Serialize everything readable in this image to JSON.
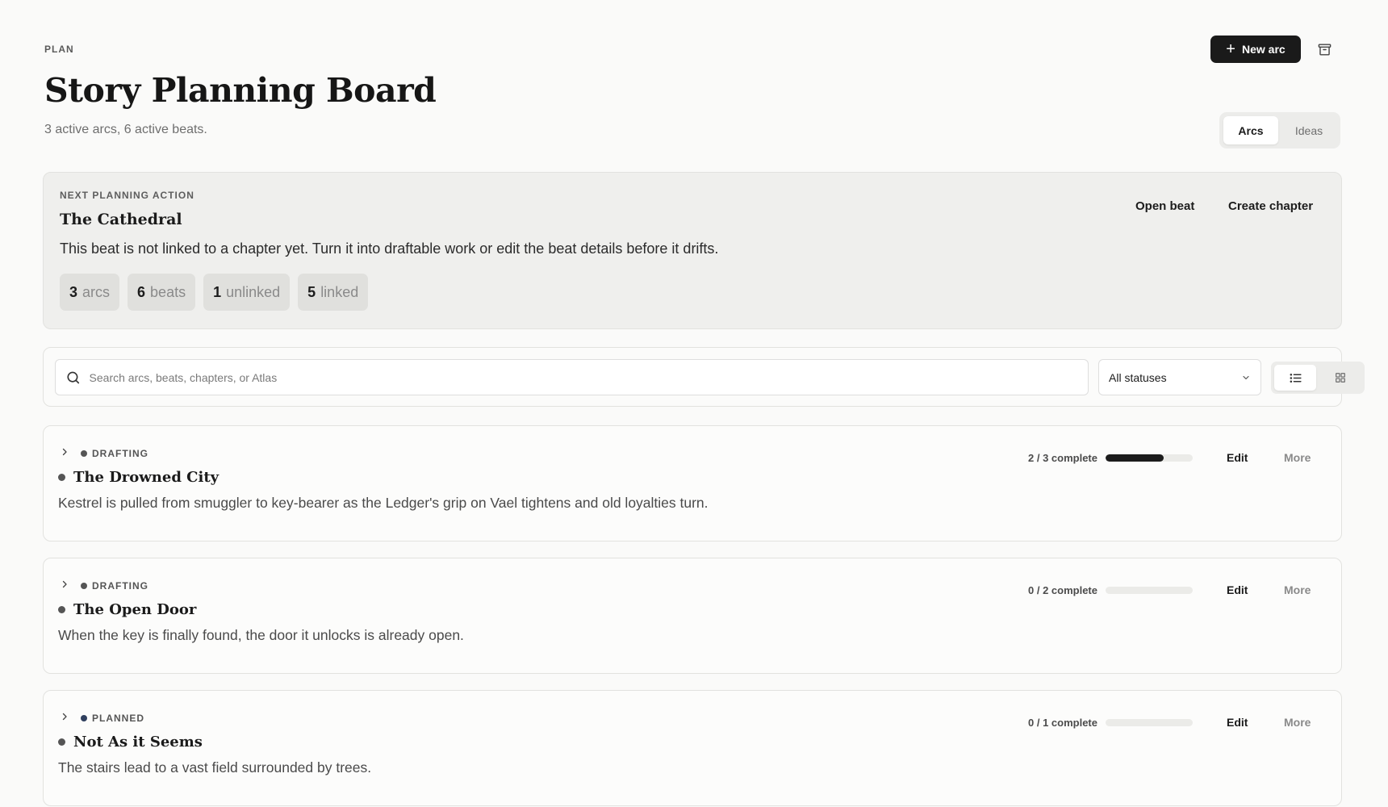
{
  "header": {
    "eyebrow": "PLAN",
    "title": "Story Planning Board",
    "subtitle": "3 active arcs, 6 active beats.",
    "new_arc_label": "New arc",
    "view_tabs": [
      {
        "label": "Arcs",
        "active": true
      },
      {
        "label": "Ideas",
        "active": false
      }
    ]
  },
  "next_action": {
    "eyebrow": "NEXT PLANNING ACTION",
    "title": "The Cathedral",
    "description": "This beat is not linked to a chapter yet. Turn it into draftable work or edit the beat details before it drifts.",
    "open_beat_label": "Open beat",
    "create_chapter_label": "Create chapter",
    "stats": [
      {
        "value": "3",
        "label": "arcs"
      },
      {
        "value": "6",
        "label": "beats"
      },
      {
        "value": "1",
        "label": "unlinked"
      },
      {
        "value": "5",
        "label": "linked"
      }
    ]
  },
  "toolbar": {
    "search_placeholder": "Search arcs, beats, chapters, or Atlas",
    "status_filter": "All statuses"
  },
  "arcs": [
    {
      "status": "DRAFTING",
      "status_color": "#555555",
      "title": "The Drowned City",
      "description": "Kestrel is pulled from smuggler to key-bearer as the Ledger's grip on Vael tightens and old loyalties turn.",
      "progress_text": "2 / 3 complete",
      "progress": 0.667,
      "edit_label": "Edit",
      "more_label": "More"
    },
    {
      "status": "DRAFTING",
      "status_color": "#555555",
      "title": "The Open Door",
      "description": "When the key is finally found, the door it unlocks is already open.",
      "progress_text": "0 / 2 complete",
      "progress": 0,
      "edit_label": "Edit",
      "more_label": "More"
    },
    {
      "status": "PLANNED",
      "status_color": "#2f3f5e",
      "title": "Not As it Seems",
      "description": "The stairs lead to a vast field surrounded by trees.",
      "progress_text": "0 / 1 complete",
      "progress": 0,
      "edit_label": "Edit",
      "more_label": "More"
    }
  ]
}
